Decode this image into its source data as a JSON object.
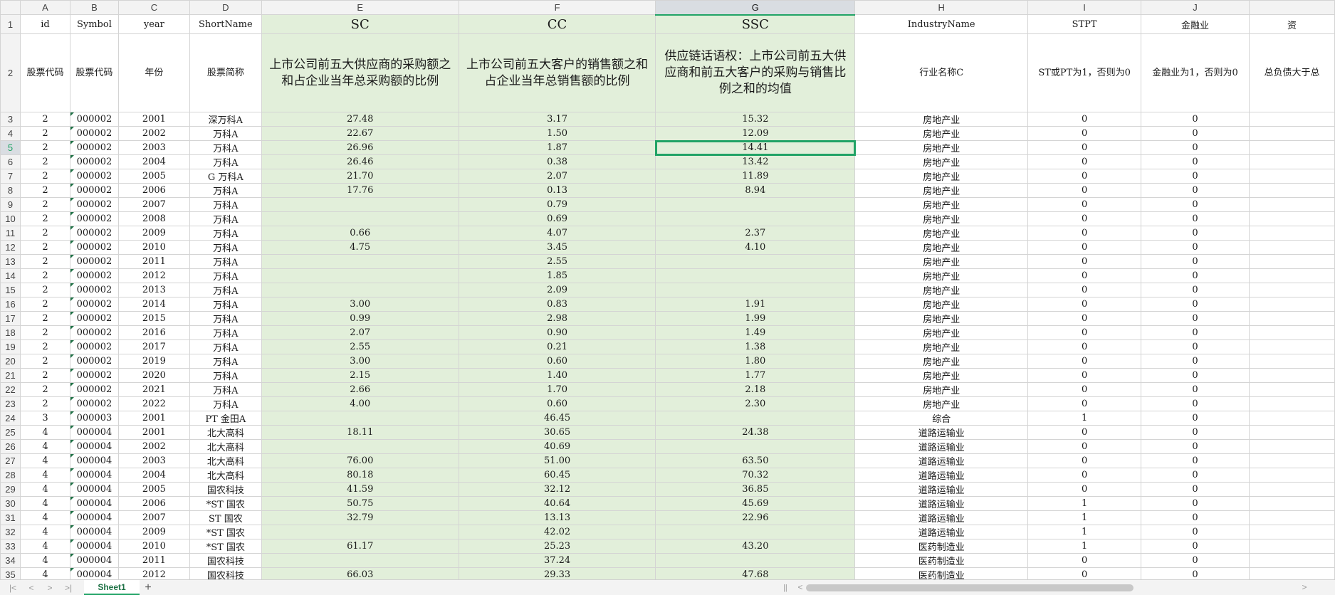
{
  "columns": [
    {
      "letter": "",
      "width": 28
    },
    {
      "letter": "A",
      "width": 70
    },
    {
      "letter": "B",
      "width": 68
    },
    {
      "letter": "C",
      "width": 100
    },
    {
      "letter": "D",
      "width": 101
    },
    {
      "letter": "E",
      "width": 277
    },
    {
      "letter": "F",
      "width": 277
    },
    {
      "letter": "G",
      "width": 280
    },
    {
      "letter": "H",
      "width": 243
    },
    {
      "letter": "I",
      "width": 159
    },
    {
      "letter": "J",
      "width": 152
    },
    {
      "letter": "",
      "width": 120
    }
  ],
  "header_row1": [
    "id",
    "Symbol",
    "year",
    "ShortName",
    "SC",
    "CC",
    "SSC",
    "IndustryName",
    "STPT",
    "金融业",
    "资"
  ],
  "header_row2": [
    "股票代码",
    "股票代码",
    "年份",
    "股票简称",
    "上市公司前五大供应商的采购额之和占企业当年总采购额的比例",
    "上市公司前五大客户的销售额之和占企业当年总销售额的比例",
    "供应链话语权：上市公司前五大供应商和前五大客户的采购与销售比例之和的均值",
    "行业名称C",
    "ST或PT为1，否则为0",
    "金融业为1，否则为0",
    "总负债大于总"
  ],
  "rows": [
    {
      "n": "3",
      "c": [
        "2",
        "000002",
        "2001",
        "深万科A",
        "27.48",
        "3.17",
        "15.32",
        "房地产业",
        "0",
        "0"
      ]
    },
    {
      "n": "4",
      "c": [
        "2",
        "000002",
        "2002",
        "万科A",
        "22.67",
        "1.50",
        "12.09",
        "房地产业",
        "0",
        "0"
      ]
    },
    {
      "n": "5",
      "c": [
        "2",
        "000002",
        "2003",
        "万科A",
        "26.96",
        "1.87",
        "14.41",
        "房地产业",
        "0",
        "0"
      ]
    },
    {
      "n": "6",
      "c": [
        "2",
        "000002",
        "2004",
        "万科A",
        "26.46",
        "0.38",
        "13.42",
        "房地产业",
        "0",
        "0"
      ]
    },
    {
      "n": "7",
      "c": [
        "2",
        "000002",
        "2005",
        "G 万科A",
        "21.70",
        "2.07",
        "11.89",
        "房地产业",
        "0",
        "0"
      ]
    },
    {
      "n": "8",
      "c": [
        "2",
        "000002",
        "2006",
        "万科A",
        "17.76",
        "0.13",
        "8.94",
        "房地产业",
        "0",
        "0"
      ]
    },
    {
      "n": "9",
      "c": [
        "2",
        "000002",
        "2007",
        "万科A",
        "",
        "0.79",
        "",
        "房地产业",
        "0",
        "0"
      ]
    },
    {
      "n": "10",
      "c": [
        "2",
        "000002",
        "2008",
        "万科A",
        "",
        "0.69",
        "",
        "房地产业",
        "0",
        "0"
      ]
    },
    {
      "n": "11",
      "c": [
        "2",
        "000002",
        "2009",
        "万科A",
        "0.66",
        "4.07",
        "2.37",
        "房地产业",
        "0",
        "0"
      ]
    },
    {
      "n": "12",
      "c": [
        "2",
        "000002",
        "2010",
        "万科A",
        "4.75",
        "3.45",
        "4.10",
        "房地产业",
        "0",
        "0"
      ]
    },
    {
      "n": "13",
      "c": [
        "2",
        "000002",
        "2011",
        "万科A",
        "",
        "2.55",
        "",
        "房地产业",
        "0",
        "0"
      ]
    },
    {
      "n": "14",
      "c": [
        "2",
        "000002",
        "2012",
        "万科A",
        "",
        "1.85",
        "",
        "房地产业",
        "0",
        "0"
      ]
    },
    {
      "n": "15",
      "c": [
        "2",
        "000002",
        "2013",
        "万科A",
        "",
        "2.09",
        "",
        "房地产业",
        "0",
        "0"
      ]
    },
    {
      "n": "16",
      "c": [
        "2",
        "000002",
        "2014",
        "万科A",
        "3.00",
        "0.83",
        "1.91",
        "房地产业",
        "0",
        "0"
      ]
    },
    {
      "n": "17",
      "c": [
        "2",
        "000002",
        "2015",
        "万科A",
        "0.99",
        "2.98",
        "1.99",
        "房地产业",
        "0",
        "0"
      ]
    },
    {
      "n": "18",
      "c": [
        "2",
        "000002",
        "2016",
        "万科A",
        "2.07",
        "0.90",
        "1.49",
        "房地产业",
        "0",
        "0"
      ]
    },
    {
      "n": "19",
      "c": [
        "2",
        "000002",
        "2017",
        "万科A",
        "2.55",
        "0.21",
        "1.38",
        "房地产业",
        "0",
        "0"
      ]
    },
    {
      "n": "20",
      "c": [
        "2",
        "000002",
        "2019",
        "万科A",
        "3.00",
        "0.60",
        "1.80",
        "房地产业",
        "0",
        "0"
      ]
    },
    {
      "n": "21",
      "c": [
        "2",
        "000002",
        "2020",
        "万科A",
        "2.15",
        "1.40",
        "1.77",
        "房地产业",
        "0",
        "0"
      ]
    },
    {
      "n": "22",
      "c": [
        "2",
        "000002",
        "2021",
        "万科A",
        "2.66",
        "1.70",
        "2.18",
        "房地产业",
        "0",
        "0"
      ]
    },
    {
      "n": "23",
      "c": [
        "2",
        "000002",
        "2022",
        "万科A",
        "4.00",
        "0.60",
        "2.30",
        "房地产业",
        "0",
        "0"
      ]
    },
    {
      "n": "24",
      "c": [
        "3",
        "000003",
        "2001",
        "PT 金田A",
        "",
        "46.45",
        "",
        "综合",
        "1",
        "0"
      ]
    },
    {
      "n": "25",
      "c": [
        "4",
        "000004",
        "2001",
        "北大高科",
        "18.11",
        "30.65",
        "24.38",
        "道路运输业",
        "0",
        "0"
      ]
    },
    {
      "n": "26",
      "c": [
        "4",
        "000004",
        "2002",
        "北大高科",
        "",
        "40.69",
        "",
        "道路运输业",
        "0",
        "0"
      ]
    },
    {
      "n": "27",
      "c": [
        "4",
        "000004",
        "2003",
        "北大高科",
        "76.00",
        "51.00",
        "63.50",
        "道路运输业",
        "0",
        "0"
      ]
    },
    {
      "n": "28",
      "c": [
        "4",
        "000004",
        "2004",
        "北大高科",
        "80.18",
        "60.45",
        "70.32",
        "道路运输业",
        "0",
        "0"
      ]
    },
    {
      "n": "29",
      "c": [
        "4",
        "000004",
        "2005",
        "国农科技",
        "41.59",
        "32.12",
        "36.85",
        "道路运输业",
        "0",
        "0"
      ]
    },
    {
      "n": "30",
      "c": [
        "4",
        "000004",
        "2006",
        "*ST 国农",
        "50.75",
        "40.64",
        "45.69",
        "道路运输业",
        "1",
        "0"
      ]
    },
    {
      "n": "31",
      "c": [
        "4",
        "000004",
        "2007",
        "ST 国农",
        "32.79",
        "13.13",
        "22.96",
        "道路运输业",
        "1",
        "0"
      ]
    },
    {
      "n": "32",
      "c": [
        "4",
        "000004",
        "2009",
        "*ST 国农",
        "",
        "42.02",
        "",
        "道路运输业",
        "1",
        "0"
      ]
    },
    {
      "n": "33",
      "c": [
        "4",
        "000004",
        "2010",
        "*ST 国农",
        "61.17",
        "25.23",
        "43.20",
        "医药制造业",
        "1",
        "0"
      ]
    },
    {
      "n": "34",
      "c": [
        "4",
        "000004",
        "2011",
        "国农科技",
        "",
        "37.24",
        "",
        "医药制造业",
        "0",
        "0"
      ]
    },
    {
      "n": "35",
      "c": [
        "4",
        "000004",
        "2012",
        "国农科技",
        "66.03",
        "29.33",
        "47.68",
        "医药制造业",
        "0",
        "0"
      ]
    }
  ],
  "sheet_tab": "Sheet1",
  "nav": {
    "first": "|<",
    "prev": "<",
    "next": ">",
    "last": ">|",
    "add": "+"
  },
  "colors": {
    "accent": "#21a366",
    "highlight": "#e2efda"
  }
}
